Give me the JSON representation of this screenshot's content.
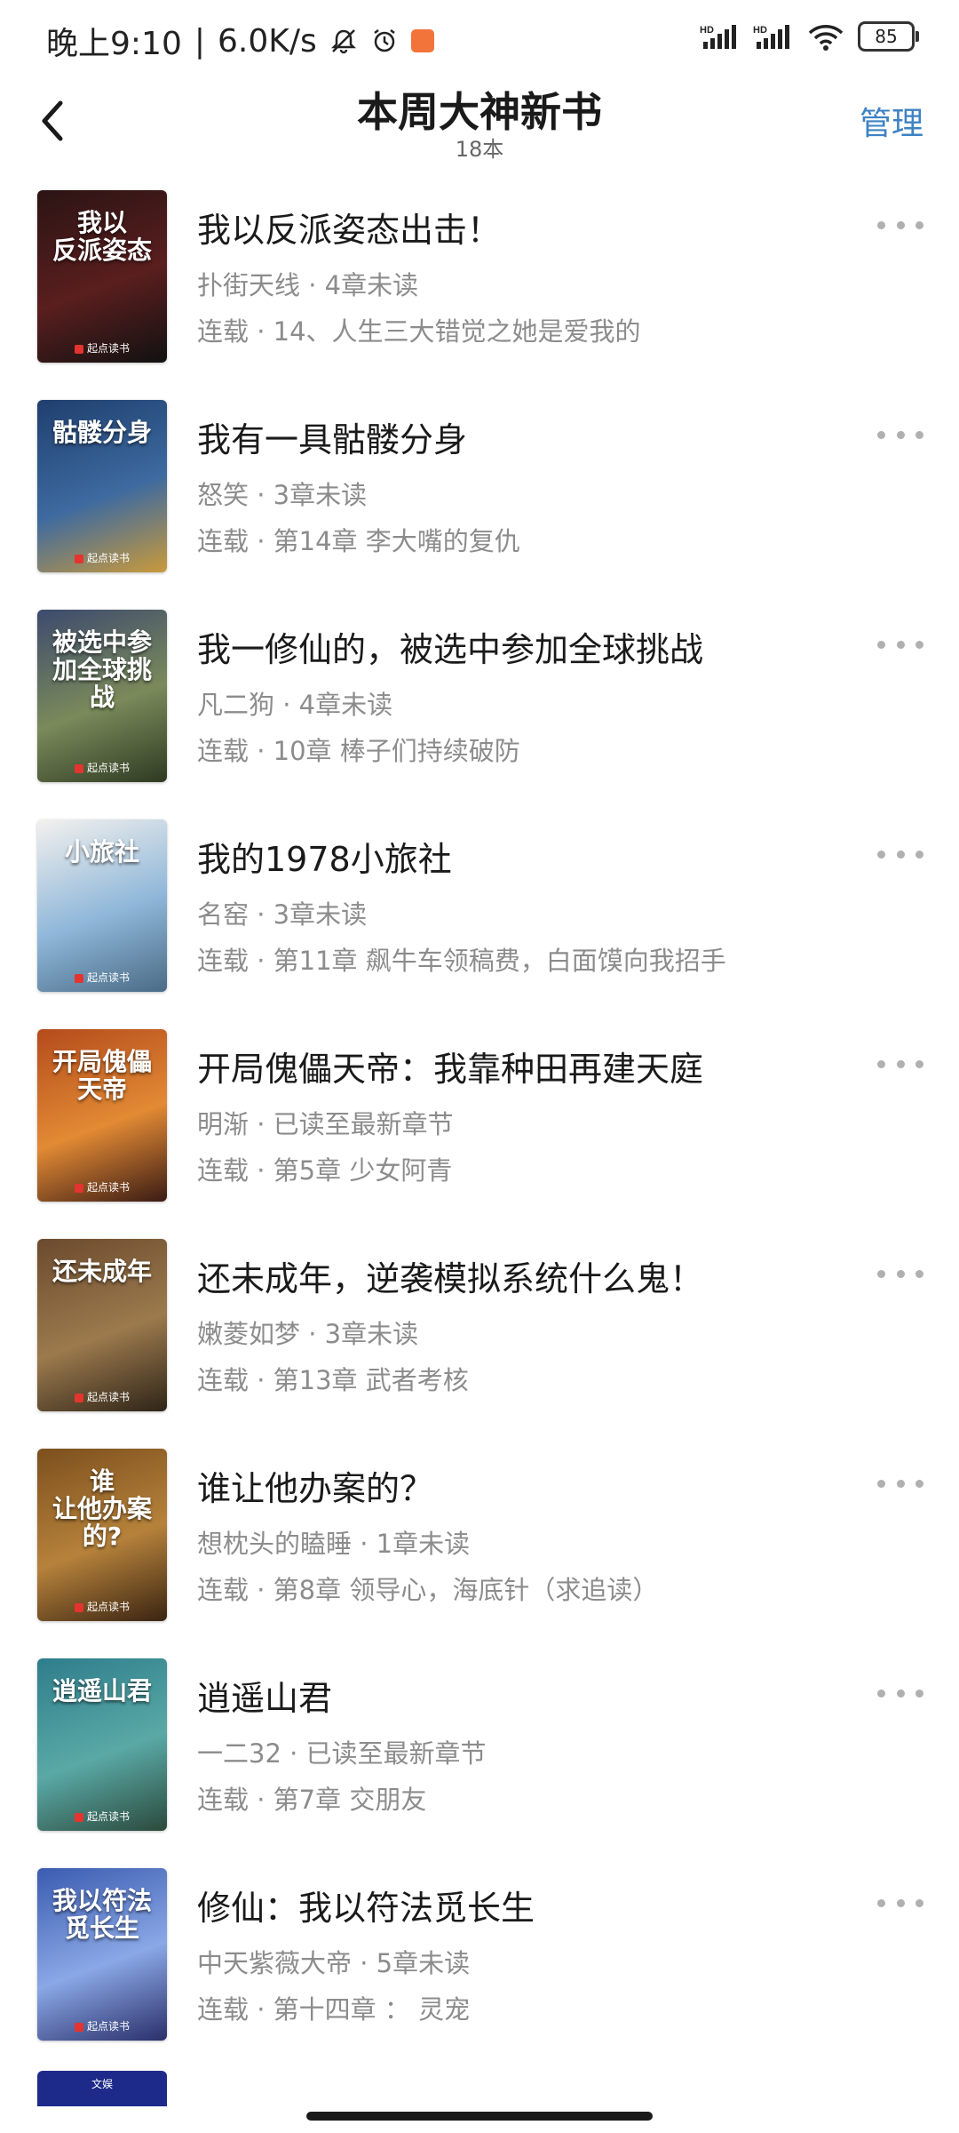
{
  "status_bar": {
    "time": "晚上9:10",
    "speed": "6.0K/s",
    "signal1_label": "HD",
    "signal2_label": "HD",
    "battery": "85"
  },
  "header": {
    "title": "本周大神新书",
    "count": "18本",
    "manage_label": "管理"
  },
  "books": [
    {
      "title": "我以反派姿态出击！",
      "meta": "扑街天线 · 4章未读",
      "chapter": "连载 · 14、人生三大错觉之她是爱我的",
      "cover_text": "我以\n反派姿态",
      "cover_colors": [
        "#2b1414",
        "#5a1e1e",
        "#111111"
      ]
    },
    {
      "title": "我有一具骷髅分身",
      "meta": "怒笑 · 3章未读",
      "chapter": "连载 · 第14章 李大嘴的复仇",
      "cover_text": "骷髅分身",
      "cover_colors": [
        "#1f3f6e",
        "#3d6aa0",
        "#c99a3b"
      ]
    },
    {
      "title": "我一修仙的，被选中参加全球挑战",
      "meta": "凡二狗 · 4章未读",
      "chapter": "连载 · 10章 棒子们持续破防",
      "cover_text": "被选中参加全球挑战",
      "cover_colors": [
        "#3d4a6e",
        "#7a8a5a",
        "#2e3a22"
      ]
    },
    {
      "title": "我的1978小旅社",
      "meta": "名窑 · 3章未读",
      "chapter": "连载 · 第11章 飙牛车领稿费，白面馍向我招手",
      "cover_text": "小旅社",
      "cover_colors": [
        "#f3f1ee",
        "#8fb7d9",
        "#4a6b86"
      ]
    },
    {
      "title": "开局傀儡天帝：我靠种田再建天庭",
      "meta": "明渐 · 已读至最新章节",
      "chapter": "连载 · 第5章 少女阿青",
      "cover_text": "开局傀儡天帝",
      "cover_colors": [
        "#b44b1c",
        "#e28a34",
        "#3a1b14"
      ]
    },
    {
      "title": "还未成年，逆袭模拟系统什么鬼！",
      "meta": "嫩菱如梦 · 3章未读",
      "chapter": "连载 · 第13章 武者考核",
      "cover_text": "还未成年",
      "cover_colors": [
        "#6b4a2e",
        "#9c7a4d",
        "#2e2418"
      ]
    },
    {
      "title": "谁让他办案的？",
      "meta": "想枕头的瞌睡 · 1章未读",
      "chapter": "连载 · 第8章 领导心，海底针（求追读）",
      "cover_text": "谁\n让他办案的?",
      "cover_colors": [
        "#7c4f1d",
        "#b6823b",
        "#3a2412"
      ]
    },
    {
      "title": "逍遥山君",
      "meta": "一二32 · 已读至最新章节",
      "chapter": "连载 · 第7章 交朋友",
      "cover_text": "逍遥山君",
      "cover_colors": [
        "#2e7d8c",
        "#5aa9a6",
        "#2b4a3c"
      ]
    },
    {
      "title": "修仙：我以符法觅长生",
      "meta": "中天紫薇大帝 · 5章未读",
      "chapter": "连载 · 第十四章 ： 灵宠",
      "cover_text": "我以符法觅长生",
      "cover_colors": [
        "#3a5bb0",
        "#8aa8e6",
        "#2a2f6a"
      ]
    }
  ],
  "cover_brand": "起点读书",
  "partial_cover_text": "文娱",
  "icons": {
    "back": "chevron-left-icon",
    "more": "more-dots-icon",
    "mute": "bell-off-icon",
    "alarm": "alarm-icon",
    "wifi": "wifi-icon"
  },
  "colors": {
    "accent": "#3d82c4",
    "secondary_text": "#8c8c8c"
  }
}
